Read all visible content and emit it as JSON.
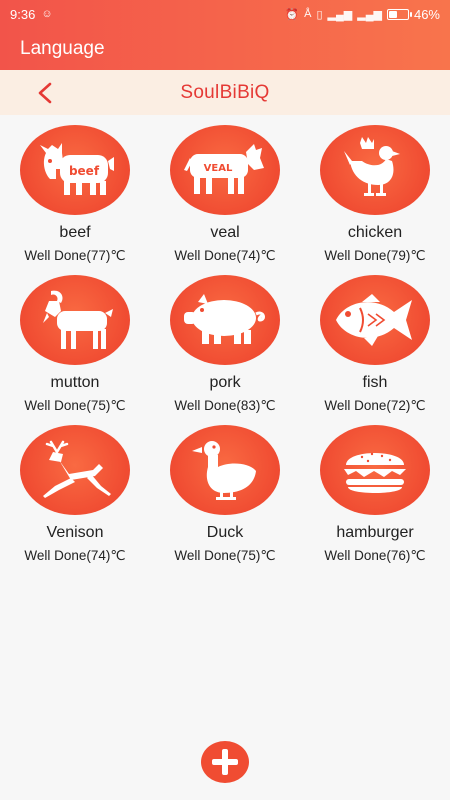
{
  "status_bar": {
    "time": "9:36",
    "battery_text": "46%",
    "battery_level": 0.46
  },
  "app_bar": {
    "title": "Language"
  },
  "sub_header": {
    "title": "SoulBiBiQ"
  },
  "foods": [
    {
      "name": "beef",
      "doneness": "Well Done(77)℃",
      "icon": "cow-icon",
      "label": "beef"
    },
    {
      "name": "veal",
      "doneness": "Well Done(74)℃",
      "icon": "calf-icon",
      "label": "VEAL"
    },
    {
      "name": "chicken",
      "doneness": "Well Done(79)℃",
      "icon": "chicken-icon"
    },
    {
      "name": "mutton",
      "doneness": "Well Done(75)℃",
      "icon": "goat-icon"
    },
    {
      "name": "pork",
      "doneness": "Well Done(83)℃",
      "icon": "pig-icon"
    },
    {
      "name": "fish",
      "doneness": "Well Done(72)℃",
      "icon": "fish-icon"
    },
    {
      "name": "Venison",
      "doneness": "Well Done(74)℃",
      "icon": "deer-icon"
    },
    {
      "name": "Duck",
      "doneness": "Well Done(75)℃",
      "icon": "duck-icon"
    },
    {
      "name": "hamburger",
      "doneness": "Well Done(76)℃",
      "icon": "burger-icon"
    }
  ],
  "colors": {
    "accent": "#f04c32",
    "title_red": "#e53935",
    "sub_header_bg": "#fbeee3"
  }
}
